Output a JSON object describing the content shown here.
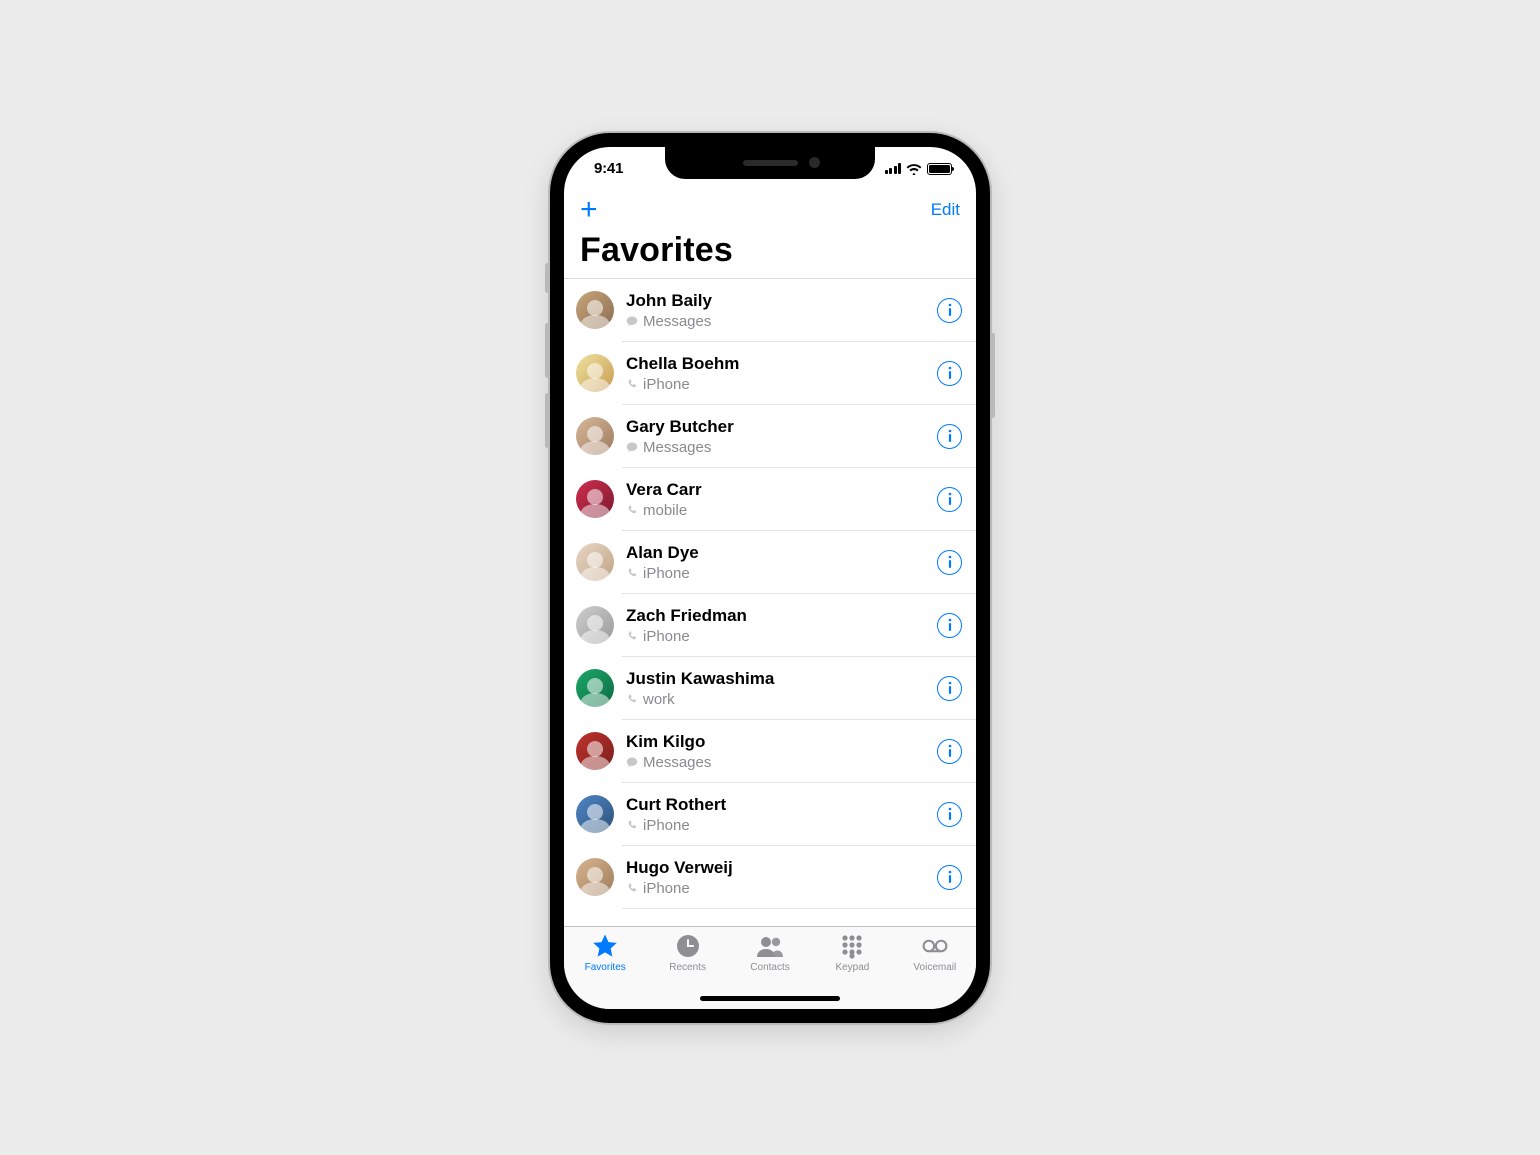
{
  "status": {
    "time": "9:41"
  },
  "nav": {
    "add_glyph": "+",
    "edit_label": "Edit"
  },
  "page": {
    "title": "Favorites"
  },
  "favorites": [
    {
      "name": "John Baily",
      "type": "messages",
      "type_label": "Messages"
    },
    {
      "name": "Chella Boehm",
      "type": "phone",
      "type_label": "iPhone"
    },
    {
      "name": "Gary Butcher",
      "type": "messages",
      "type_label": "Messages"
    },
    {
      "name": "Vera Carr",
      "type": "phone",
      "type_label": "mobile"
    },
    {
      "name": "Alan Dye",
      "type": "phone",
      "type_label": "iPhone"
    },
    {
      "name": "Zach Friedman",
      "type": "phone",
      "type_label": "iPhone"
    },
    {
      "name": "Justin Kawashima",
      "type": "phone",
      "type_label": "work"
    },
    {
      "name": "Kim Kilgo",
      "type": "messages",
      "type_label": "Messages"
    },
    {
      "name": "Curt Rothert",
      "type": "phone",
      "type_label": "iPhone"
    },
    {
      "name": "Hugo Verweij",
      "type": "phone",
      "type_label": "iPhone"
    }
  ],
  "tabs": [
    {
      "id": "favorites",
      "label": "Favorites",
      "active": true
    },
    {
      "id": "recents",
      "label": "Recents",
      "active": false
    },
    {
      "id": "contacts",
      "label": "Contacts",
      "active": false
    },
    {
      "id": "keypad",
      "label": "Keypad",
      "active": false
    },
    {
      "id": "voicemail",
      "label": "Voicemail",
      "active": false
    }
  ]
}
